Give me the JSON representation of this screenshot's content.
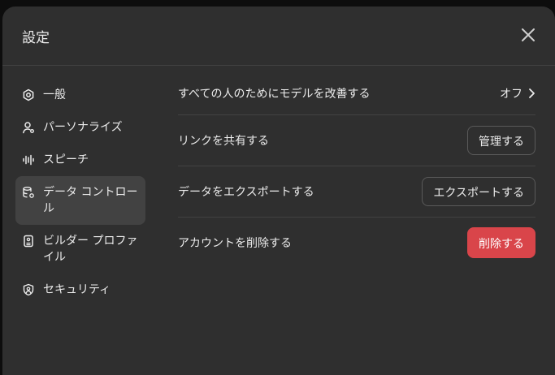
{
  "dialog": {
    "title": "設定",
    "close_icon": "close-icon"
  },
  "sidebar": {
    "items": [
      {
        "label": "一般",
        "icon": "gear-icon"
      },
      {
        "label": "パーソナライズ",
        "icon": "person-icon"
      },
      {
        "label": "スピーチ",
        "icon": "waveform-icon"
      },
      {
        "label": "データ コントロール",
        "icon": "database-gear-icon",
        "active": true
      },
      {
        "label": "ビルダー プロファイル",
        "icon": "id-card-icon"
      },
      {
        "label": "セキュリティ",
        "icon": "shield-user-icon"
      }
    ]
  },
  "rows": [
    {
      "label": "すべての人のためにモデルを改善する",
      "action": "オフ",
      "icon": "chevron-right-icon"
    },
    {
      "label": "リンクを共有する",
      "action": "管理する"
    },
    {
      "label": "データをエクスポートする",
      "action": "エクスポートする"
    },
    {
      "label": "アカウントを削除する",
      "action": "削除する"
    }
  ],
  "colors": {
    "background": "#2f2f2f",
    "active_item": "#424242",
    "danger": "#d9454a"
  }
}
